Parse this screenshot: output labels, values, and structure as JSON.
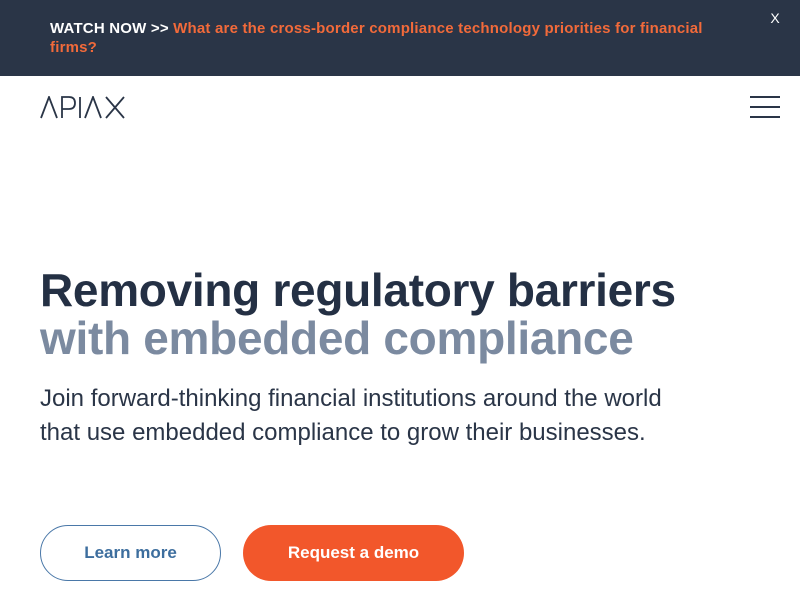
{
  "banner": {
    "prefix": "WATCH NOW >>",
    "link_text": "What are the cross-border compliance technology priorities for financial firms?",
    "close_label": "X"
  },
  "header": {
    "logo_text": "APIAX",
    "menu_icon": "hamburger-menu-icon"
  },
  "hero": {
    "title_line1": "Removing regulatory barriers",
    "title_line2": "with embedded compliance",
    "subtitle": "Join forward-thinking financial institutions around the world that use embedded compliance to grow their businesses."
  },
  "actions": {
    "learn_more_label": "Learn more",
    "request_demo_label": "Request a demo"
  },
  "colors": {
    "banner_bg": "#2a3547",
    "accent_orange": "#f2572b",
    "heading_dark": "#243044",
    "heading_muted": "#7b8aa0",
    "link_blue": "#3d6e9e"
  }
}
